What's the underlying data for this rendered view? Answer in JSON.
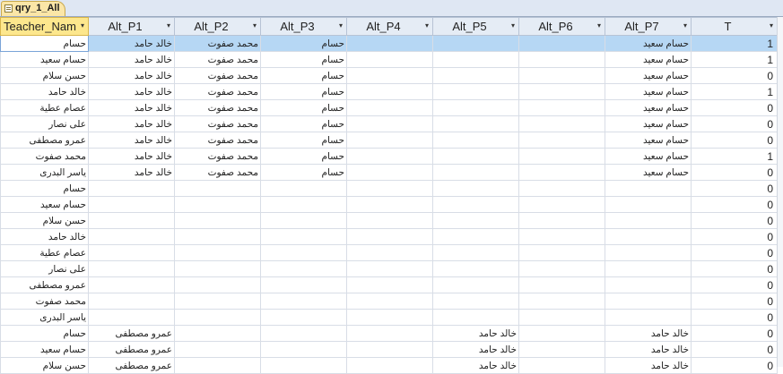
{
  "tab": {
    "label": "qry_1_All",
    "icon": "query-icon"
  },
  "columns": [
    "Teacher_Nam",
    "Alt_P1",
    "Alt_P2",
    "Alt_P3",
    "Alt_P4",
    "Alt_P5",
    "Alt_P6",
    "Alt_P7",
    "T"
  ],
  "dropdown_icon": "▾",
  "rows": [
    [
      "حسام",
      "خالد حامد",
      "محمد صفوت",
      "حسام",
      "",
      "",
      "",
      "حسام سعيد",
      "1"
    ],
    [
      "حسام سعيد",
      "خالد حامد",
      "محمد صفوت",
      "حسام",
      "",
      "",
      "",
      "حسام سعيد",
      "1"
    ],
    [
      "حسن سلام",
      "خالد حامد",
      "محمد صفوت",
      "حسام",
      "",
      "",
      "",
      "حسام سعيد",
      "0"
    ],
    [
      "خالد حامد",
      "خالد حامد",
      "محمد صفوت",
      "حسام",
      "",
      "",
      "",
      "حسام سعيد",
      "1"
    ],
    [
      "عصام عطية",
      "خالد حامد",
      "محمد صفوت",
      "حسام",
      "",
      "",
      "",
      "حسام سعيد",
      "0"
    ],
    [
      "على نصار",
      "خالد حامد",
      "محمد صفوت",
      "حسام",
      "",
      "",
      "",
      "حسام سعيد",
      "0"
    ],
    [
      "عمرو مصطفى",
      "خالد حامد",
      "محمد صفوت",
      "حسام",
      "",
      "",
      "",
      "حسام سعيد",
      "0"
    ],
    [
      "محمد صفوت",
      "خالد حامد",
      "محمد صفوت",
      "حسام",
      "",
      "",
      "",
      "حسام سعيد",
      "1"
    ],
    [
      "ياسر البدرى",
      "خالد حامد",
      "محمد صفوت",
      "حسام",
      "",
      "",
      "",
      "حسام سعيد",
      "0"
    ],
    [
      "حسام",
      "",
      "",
      "",
      "",
      "",
      "",
      "",
      "0"
    ],
    [
      "حسام سعيد",
      "",
      "",
      "",
      "",
      "",
      "",
      "",
      "0"
    ],
    [
      "حسن سلام",
      "",
      "",
      "",
      "",
      "",
      "",
      "",
      "0"
    ],
    [
      "خالد حامد",
      "",
      "",
      "",
      "",
      "",
      "",
      "",
      "0"
    ],
    [
      "عصام عطية",
      "",
      "",
      "",
      "",
      "",
      "",
      "",
      "0"
    ],
    [
      "على نصار",
      "",
      "",
      "",
      "",
      "",
      "",
      "",
      "0"
    ],
    [
      "عمرو مصطفى",
      "",
      "",
      "",
      "",
      "",
      "",
      "",
      "0"
    ],
    [
      "محمد صفوت",
      "",
      "",
      "",
      "",
      "",
      "",
      "",
      "0"
    ],
    [
      "ياسر البدرى",
      "",
      "",
      "",
      "",
      "",
      "",
      "",
      "0"
    ],
    [
      "حسام",
      "عمرو مصطفى",
      "",
      "",
      "",
      "خالد حامد",
      "",
      "خالد حامد",
      "0"
    ],
    [
      "حسام سعيد",
      "عمرو مصطفى",
      "",
      "",
      "",
      "خالد حامد",
      "",
      "خالد حامد",
      "0"
    ],
    [
      "حسن سلام",
      "عمرو مصطفى",
      "",
      "",
      "",
      "خالد حامد",
      "",
      "خالد حامد",
      "0"
    ]
  ]
}
